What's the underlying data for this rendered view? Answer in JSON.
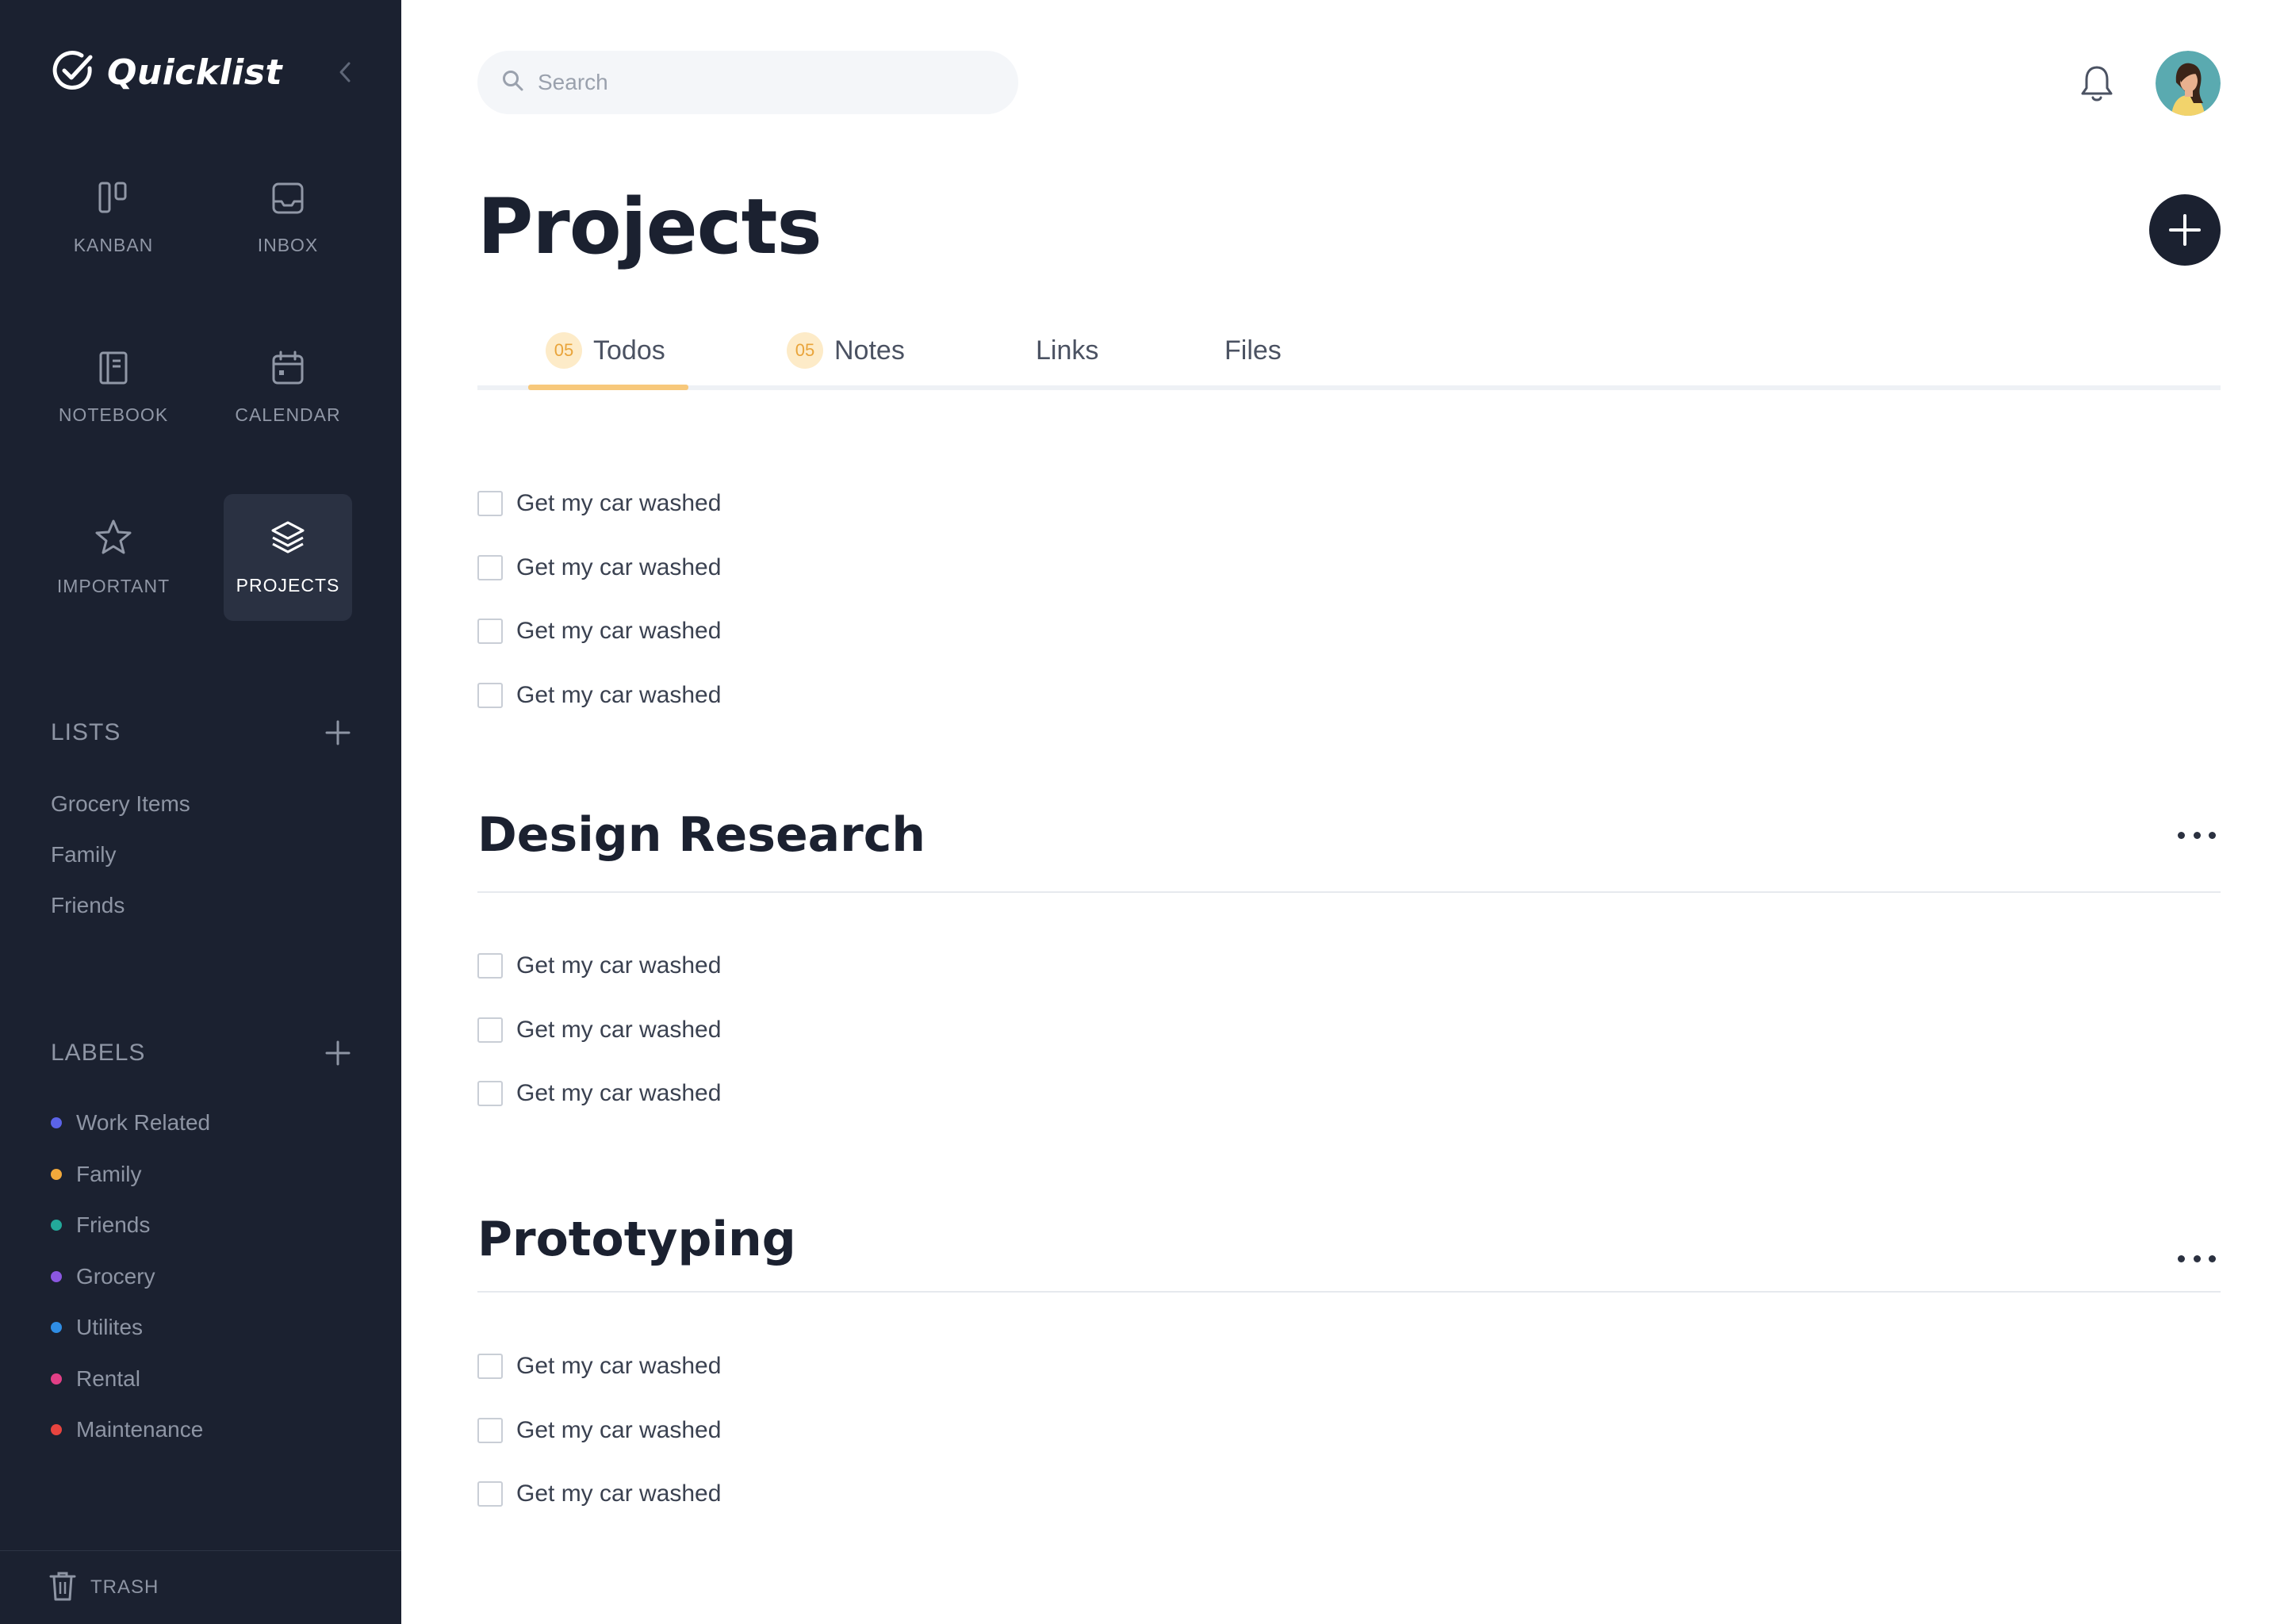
{
  "app": {
    "name": "Quicklist"
  },
  "sidebar": {
    "nav": [
      {
        "label": "KANBAN",
        "icon": "kanban-icon"
      },
      {
        "label": "INBOX",
        "icon": "inbox-icon"
      },
      {
        "label": "NOTEBOOK",
        "icon": "notebook-icon"
      },
      {
        "label": "CALENDAR",
        "icon": "calendar-icon"
      },
      {
        "label": "IMPORTANT",
        "icon": "star-icon"
      },
      {
        "label": "PROJECTS",
        "icon": "layers-icon",
        "active": true
      }
    ],
    "lists": {
      "title": "LISTS",
      "items": [
        "Grocery Items",
        "Family",
        "Friends"
      ]
    },
    "labels": {
      "title": "LABELS",
      "items": [
        {
          "label": "Work Related",
          "color": "#5b63e8"
        },
        {
          "label": "Family",
          "color": "#f2a93b"
        },
        {
          "label": "Friends",
          "color": "#23a99a"
        },
        {
          "label": "Grocery",
          "color": "#8b57e0"
        },
        {
          "label": "Utilites",
          "color": "#2f8de4"
        },
        {
          "label": "Rental",
          "color": "#e23f86"
        },
        {
          "label": "Maintenance",
          "color": "#e8443f"
        }
      ]
    },
    "trash_label": "TRASH"
  },
  "header": {
    "search_placeholder": "Search"
  },
  "main": {
    "title": "Projects",
    "tabs": [
      {
        "label": "Todos",
        "count": "05",
        "active": true
      },
      {
        "label": "Notes",
        "count": "05"
      },
      {
        "label": "Links"
      },
      {
        "label": "Files"
      }
    ],
    "groups": [
      {
        "title": "",
        "todos": [
          "Get my car washed",
          "Get my car washed",
          "Get my car washed",
          "Get my car washed"
        ]
      },
      {
        "title": "Design Research",
        "todos": [
          "Get my car washed",
          "Get my car washed",
          "Get my car washed"
        ]
      },
      {
        "title": "Prototyping",
        "todos": [
          "Get my car washed",
          "Get my car washed",
          "Get my car washed"
        ]
      }
    ]
  },
  "colors": {
    "sidebar_bg": "#1b2130",
    "accent": "#f7c87b",
    "badge_bg": "#fdebc8",
    "badge_text": "#e9a43a"
  }
}
